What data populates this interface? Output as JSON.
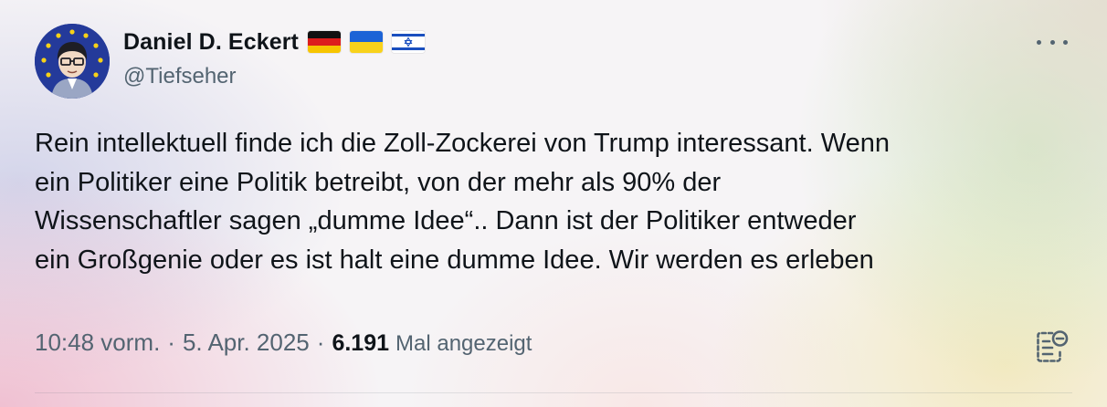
{
  "author": {
    "name": "Daniel D. Eckert",
    "handle": "@Tiefseher",
    "flags": [
      "germany-flag",
      "ukraine-flag",
      "israel-flag"
    ]
  },
  "tweet": {
    "lines": [
      "Rein intellektuell finde ich die Zoll-Zockerei von Trump interessant. Wenn",
      "ein Politiker eine Politik betreibt, von der mehr als 90% der",
      "Wissenschaftler sagen „dumme Idee“.. Dann ist der Politiker entweder",
      "ein Großgenie oder es ist halt eine dumme Idee. Wir werden es erleben"
    ]
  },
  "meta": {
    "time": "10:48 vorm.",
    "separator": "·",
    "date": "5. Apr. 2025",
    "views_count": "6.191",
    "views_label": "Mal angezeigt"
  },
  "icons": {
    "more": "more-options-icon",
    "notes": "community-notes-icon"
  },
  "colors": {
    "text": "#0f1419",
    "secondary": "#536471",
    "avatar_bg": "#243a9a",
    "eu_star": "#f7d117"
  }
}
